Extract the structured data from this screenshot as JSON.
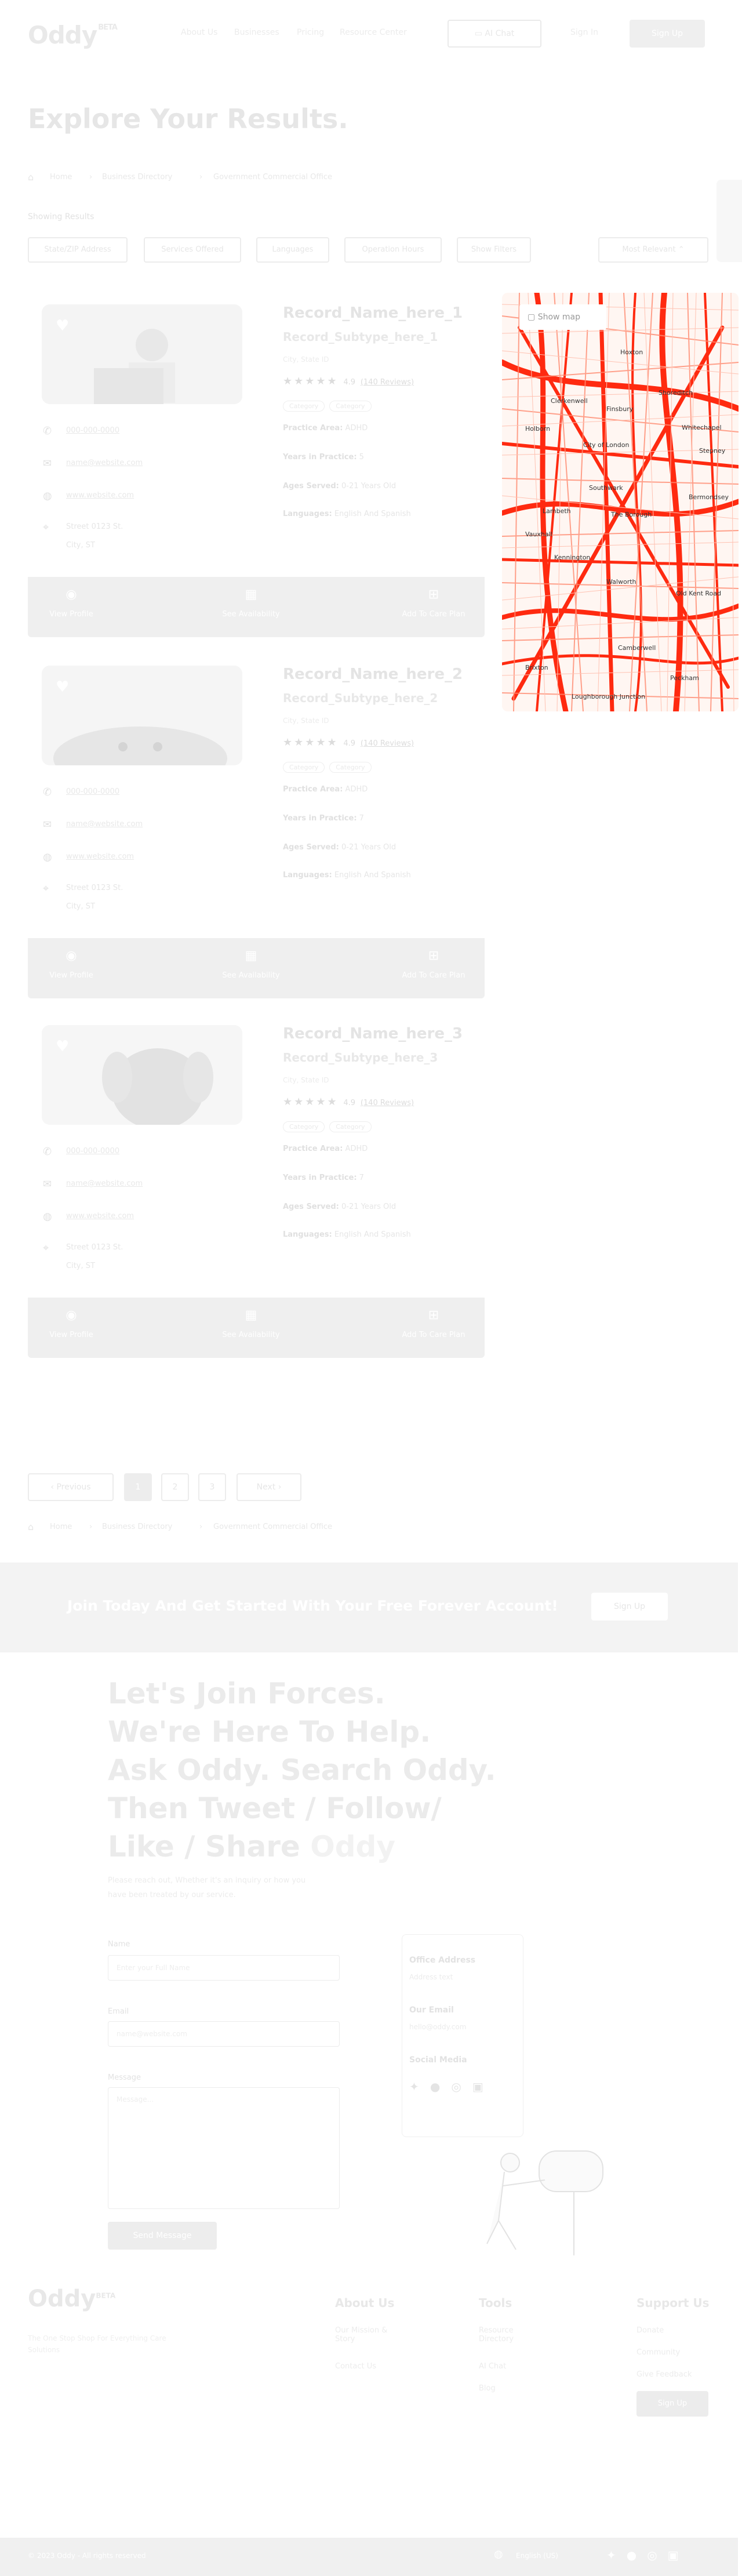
{
  "header": {
    "logo": "Oddy",
    "logo_badge": "BETA",
    "nav": [
      "About Us",
      "Businesses",
      "Pricing",
      "Resource Center"
    ],
    "ai_chat": "AI Chat",
    "sign_in": "Sign In",
    "sign_up": "Sign Up"
  },
  "page": {
    "title": "Explore Your Results.",
    "breadcrumb": [
      "Home",
      "Business Directory",
      "Government Commercial Office"
    ],
    "showing": "Showing Results",
    "filters": [
      "State/ZIP Address",
      "Services Offered",
      "Languages",
      "Operation Hours",
      "Show Filters"
    ],
    "sort": "Most Relevant"
  },
  "records": [
    {
      "name": "Record_Name_here_1",
      "subtype": "Record_Subtype_here_1",
      "small": "City, State ID",
      "rating": "4.9",
      "reviews": "(140 Reviews)",
      "tags": [
        "Category",
        "Category"
      ],
      "phone": "000-000-0000",
      "email": "name@website.com",
      "website": "www.website.com",
      "address1": "Street 0123 St.",
      "address2": "City, ST",
      "practice_label": "Practice Area:",
      "practice": "ADHD",
      "years_label": "Years in Practice:",
      "years": "5",
      "ages_label": "Ages Served:",
      "ages": "0-21 Years Old",
      "lang_label": "Languages:",
      "lang": "English And Spanish",
      "actions": [
        "View Profile",
        "See Availability",
        "Add To Care Plan"
      ]
    },
    {
      "name": "Record_Name_here_2",
      "subtype": "Record_Subtype_here_2",
      "small": "City, State ID",
      "rating": "4.9",
      "reviews": "(140 Reviews)",
      "tags": [
        "Category",
        "Category"
      ],
      "phone": "000-000-0000",
      "email": "name@website.com",
      "website": "www.website.com",
      "address1": "Street 0123 St.",
      "address2": "City, ST",
      "practice_label": "Practice Area:",
      "practice": "ADHD",
      "years_label": "Years in Practice:",
      "years": "7",
      "ages_label": "Ages Served:",
      "ages": "0-21 Years Old",
      "lang_label": "Languages:",
      "lang": "English And Spanish",
      "actions": [
        "View Profile",
        "See Availability",
        "Add To Care Plan"
      ]
    },
    {
      "name": "Record_Name_here_3",
      "subtype": "Record_Subtype_here_3",
      "small": "City, State ID",
      "rating": "4.9",
      "reviews": "(140 Reviews)",
      "tags": [
        "Category",
        "Category"
      ],
      "phone": "000-000-0000",
      "email": "name@website.com",
      "website": "www.website.com",
      "address1": "Street 0123 St.",
      "address2": "City, ST",
      "practice_label": "Practice Area:",
      "practice": "ADHD",
      "years_label": "Years in Practice:",
      "years": "7",
      "ages_label": "Ages Served:",
      "ages": "0-21 Years Old",
      "lang_label": "Languages:",
      "lang": "English And Spanish",
      "actions": [
        "View Profile",
        "See Availability",
        "Add To Care Plan"
      ]
    }
  ],
  "map": {
    "show_map": "Show map",
    "labels": [
      "Hoxton",
      "Shoreditch",
      "Clerkenwell",
      "Finsbury",
      "Whitechapel",
      "City of London",
      "Stepney",
      "Holborn",
      "Southwark",
      "Bermondsey",
      "Lambeth",
      "Kennington",
      "Walworth",
      "Old Kent Road",
      "Peckham",
      "Brixton",
      "Camberwell",
      "Vauxhall",
      "Loughborough Junction",
      "The Borough"
    ]
  },
  "pagination": {
    "previous": "Previous",
    "pages": [
      "1",
      "2",
      "3"
    ],
    "next": "Next"
  },
  "banner": {
    "text": "Join Today And Get Started With Your Free Forever Account!",
    "cta": "Sign Up"
  },
  "join": {
    "headline_1": "Let's Join Forces.",
    "headline_2": "We're Here To Help.",
    "headline_3": "Ask Oddy. Search Oddy.",
    "headline_4": "Then Tweet / Follow/",
    "headline_5a": "Like / Share",
    "headline_5b": "Oddy",
    "subtext_1": "Please reach out, Whether it's an inquiry or how you",
    "subtext_2": "have been treated by our service.",
    "name_label": "Name",
    "name_placeholder": "Enter your Full Name",
    "email_label": "Email",
    "email_placeholder": "name@website.com",
    "message_label": "Message",
    "message_placeholder": "Message...",
    "send": "Send Message",
    "office_title": "Office Address",
    "office_value": "Address text",
    "email_title": "Our Email",
    "email_value": "hello@oddy.com",
    "social_title": "Social Media"
  },
  "footer": {
    "logo": "Oddy",
    "logo_badge": "BETA",
    "tagline_1": "The One Stop Shop For Everything Care",
    "tagline_2": "Solutions",
    "about_title": "About Us",
    "about_links": [
      "Our Mission & Story",
      "Contact Us"
    ],
    "tools_title": "Tools",
    "tools_links": [
      "Resource Directory",
      "AI Chat",
      "Blog"
    ],
    "support_title": "Support Us",
    "support_links": [
      "Donate",
      "Community",
      "Give Feedback"
    ],
    "support_cta": "Sign Up",
    "copyright": "© 2023 Oddy - All rights reserved",
    "lang": "English (US)"
  }
}
